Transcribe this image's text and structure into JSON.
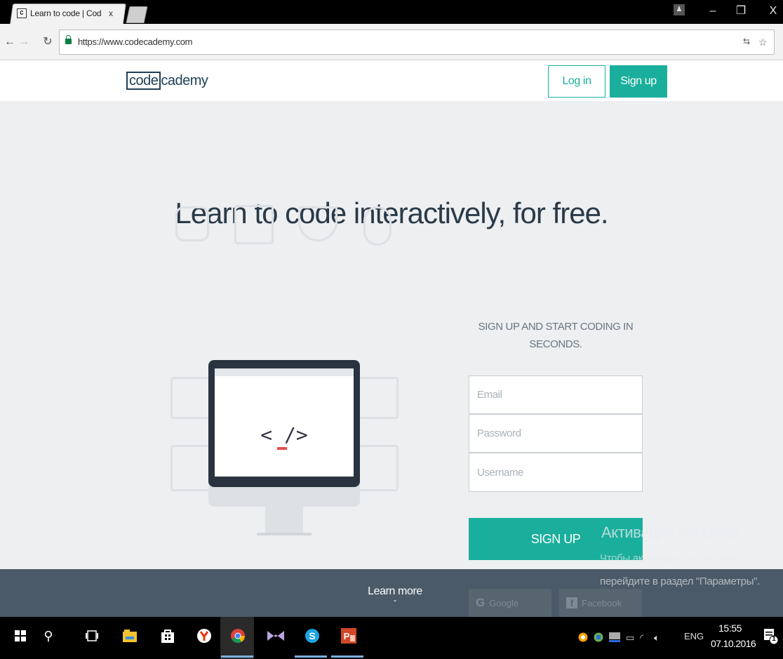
{
  "browser": {
    "tab_title": "Learn to code | Cod",
    "tab_close": "x",
    "favicon_text": "C",
    "url": "https://www.codecademy.com",
    "window_controls": {
      "minimize": "–",
      "restore": "❐",
      "close": "X"
    }
  },
  "site": {
    "logo_boxed": "code",
    "logo_rest": "cademy",
    "login_label": "Log in",
    "signup_label": "Sign up",
    "headline": "Learn to code interactively, for free.",
    "monitor_symbol": "< /> ",
    "form": {
      "title": "SIGN UP AND START CODING IN SECONDS.",
      "email_placeholder": "Email",
      "password_placeholder": "Password",
      "username_placeholder": "Username",
      "submit_label": "SIGN UP"
    },
    "learn_more": "Learn more",
    "learn_more_chevron": "ˇ",
    "social": {
      "google_label": "Google",
      "facebook_label": "Facebook"
    },
    "accent_color": "#1aaf9c"
  },
  "watermark": {
    "title": "Активация Windows",
    "line1": "Чтобы активировать Windows,",
    "line2": "перейдите в раздел \"Параметры\"."
  },
  "taskbar": {
    "language": "ENG",
    "time": "15:55",
    "date": "07.10.2016",
    "notification_count": "1"
  }
}
